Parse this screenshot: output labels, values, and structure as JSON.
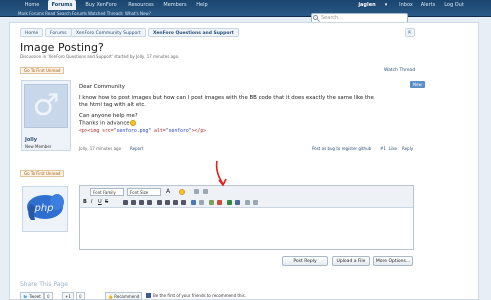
{
  "nav": {
    "tabs": [
      "Home",
      "Forums",
      "Buy XenForo",
      "Resources",
      "Members",
      "Help"
    ],
    "sub_items": [
      "Mark Forums Read",
      "Search Forums",
      "Watched Threads",
      "What's New?"
    ],
    "user": "jaglen",
    "user_links": [
      "Inbox",
      "Alerts",
      "Log Out"
    ]
  },
  "search": {
    "placeholder": "Search..."
  },
  "breadcrumbs": [
    "Home",
    "Forums",
    "XenForo Community Support",
    "XenForo Questions and Support"
  ],
  "thread": {
    "title": "Image Posting?",
    "meta": "Discussion in 'XenForo Questions and Support' started by Jolly, 17 minutes ago.",
    "first_unread": "Go To First Unread",
    "watch": "Watch Thread"
  },
  "post": {
    "username": "Jolly",
    "user_title": "New Member",
    "greeting": "Dear Community",
    "line1": "I know how to post images but how can I post images with the BB code that it does exactly the same like the",
    "line2": "the html tag with alt etc.",
    "line3": "Can anyone help me?",
    "line4": "Thanks in advance",
    "code_tag": "<p><img src=",
    "code_src": "\"xenforo.png\"",
    "code_alt_attr": " alt=",
    "code_alt": "\"xenforo\"",
    "code_end": "></p>",
    "new_badge": "New",
    "meta": "Jolly, 17 minutes ago",
    "report": "Report",
    "bug_link": "Post as bug to register github",
    "number": "#1",
    "like": "Like",
    "reply": "Reply"
  },
  "editor": {
    "font_family": "Font Family",
    "font_size": "Font Size",
    "post_reply": "Post Reply",
    "upload": "Upload a File",
    "more": "More Options..."
  },
  "share": {
    "title": "Share This Page",
    "tweet": "Tweet",
    "tweet_count": "0",
    "gplus": "+1",
    "gplus_count": "0",
    "recommend": "Recommend",
    "recommend_text": "Be the first of your friends to recommend this."
  },
  "colors": {
    "header": "#19446d",
    "accent": "#2a4f7a",
    "annotation_arrow": "#e0201a"
  }
}
